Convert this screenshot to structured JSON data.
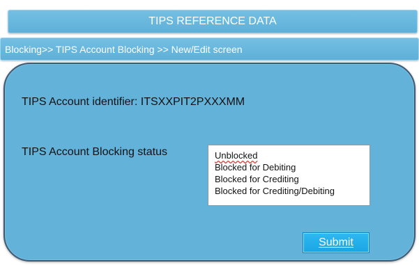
{
  "header": {
    "title": "TIPS REFERENCE DATA",
    "breadcrumb": "Blocking>> TIPS Account Blocking >> New/Edit screen"
  },
  "form": {
    "identifier_text": "TIPS Account identifier: ITSXXPIT2PXXXMM",
    "status_label": "TIPS Account Blocking status",
    "status_options": [
      "Unblocked",
      "Blocked for Debiting",
      "Blocked for Crediting",
      "Blocked for Crediting/Debiting"
    ],
    "submit_label": "Submit"
  },
  "colors": {
    "header_bg": "#5eb0d8",
    "panel_bg": "#63b2da",
    "panel_border": "#3e5b73",
    "submit_bg": "#1aa5e4"
  }
}
